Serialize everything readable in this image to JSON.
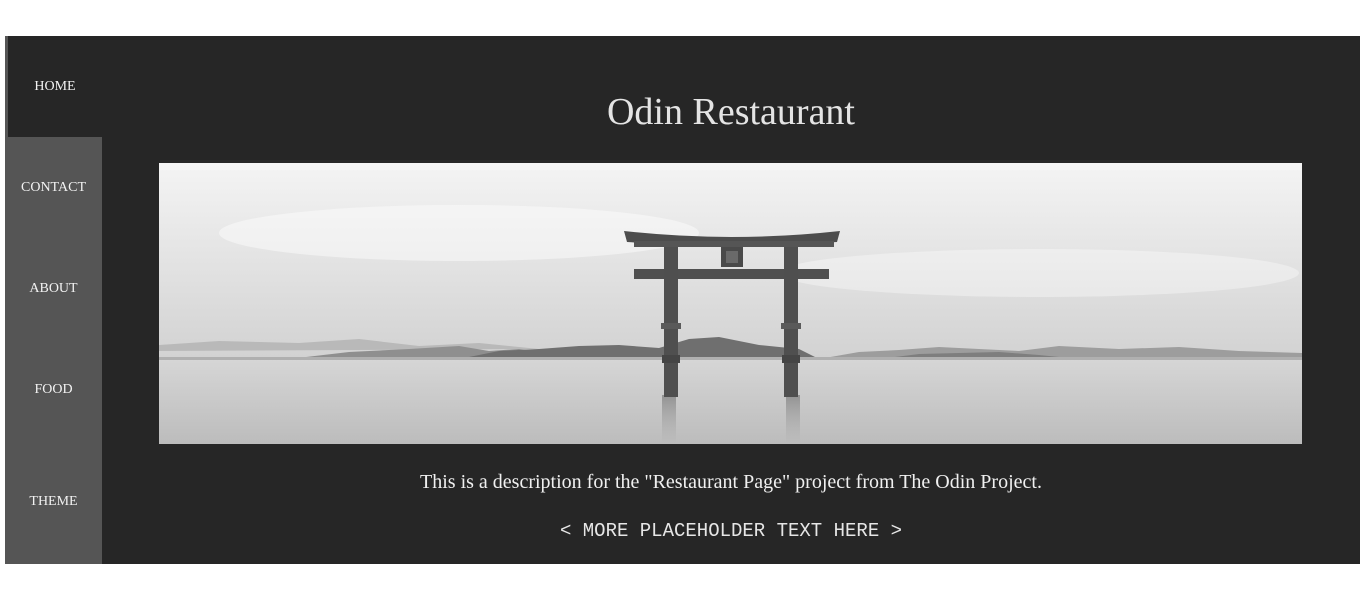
{
  "nav": {
    "items": [
      {
        "label": "HOME"
      },
      {
        "label": "CONTACT"
      },
      {
        "label": "ABOUT"
      },
      {
        "label": "FOOD"
      },
      {
        "label": "THEME"
      }
    ],
    "active": "HOME"
  },
  "main": {
    "title": "Odin Restaurant",
    "hero_image": "torii-gate-lake-photo",
    "description": "This is a description for the \"Restaurant Page\" project from The Odin Project.",
    "placeholder": "< MORE PLACEHOLDER TEXT HERE >"
  },
  "colors": {
    "page_bg": "#262626",
    "sidebar_bg": "#555555",
    "text": "#f0f0f0"
  }
}
